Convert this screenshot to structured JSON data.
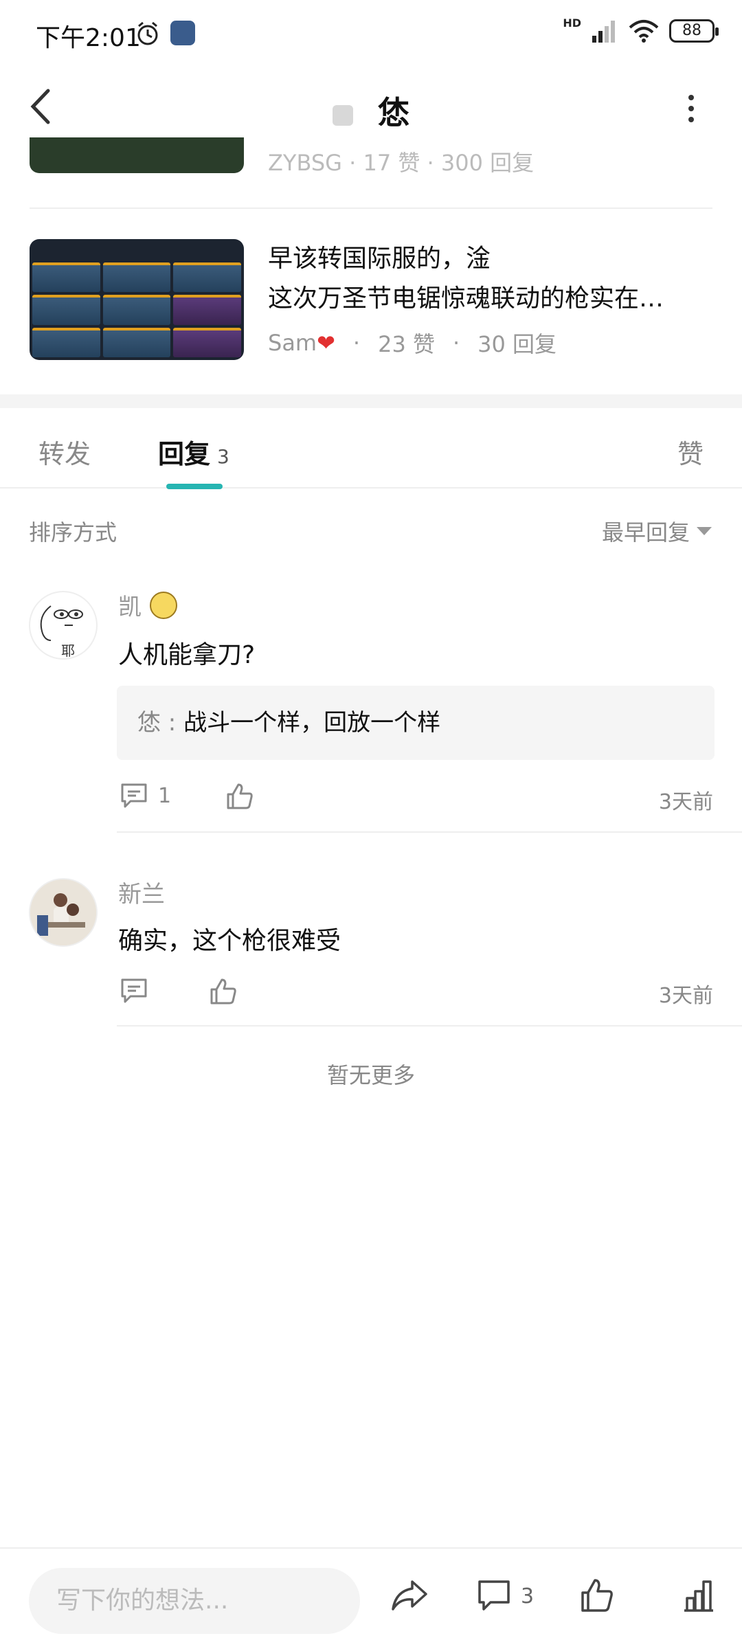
{
  "status_bar": {
    "time": "下午2:01",
    "network": "HD",
    "battery": "88"
  },
  "nav": {
    "title": "恷"
  },
  "recommended": {
    "partial_meta": "ZYBSG · 17 赞 · 300 回复",
    "item": {
      "title_line1": "早该转国际服的，淦",
      "title_line2": "这次万圣节电锯惊魂联动的枪实在…",
      "author": "Sam",
      "likes": "23 赞",
      "replies": "30 回复"
    }
  },
  "tabs": [
    {
      "label": "转发"
    },
    {
      "label": "回复",
      "count": "3"
    },
    {
      "label": "赞"
    }
  ],
  "sort": {
    "label": "排序方式",
    "value": "最早回复"
  },
  "comments": [
    {
      "name": "凯",
      "text": "人机能拿刀?",
      "reply_author": "恷",
      "reply_text": "战斗一个样，回放一个样",
      "reply_count": "1",
      "time": "3天前"
    },
    {
      "name": "新兰",
      "text": "确实，这个枪很难受",
      "time": "3天前"
    }
  ],
  "no_more": "暂无更多",
  "bottom_bar": {
    "input_placeholder": "写下你的想法...",
    "comment_count": "3"
  },
  "colors": {
    "accent": "#26b5b2",
    "heart": "#e23030"
  }
}
